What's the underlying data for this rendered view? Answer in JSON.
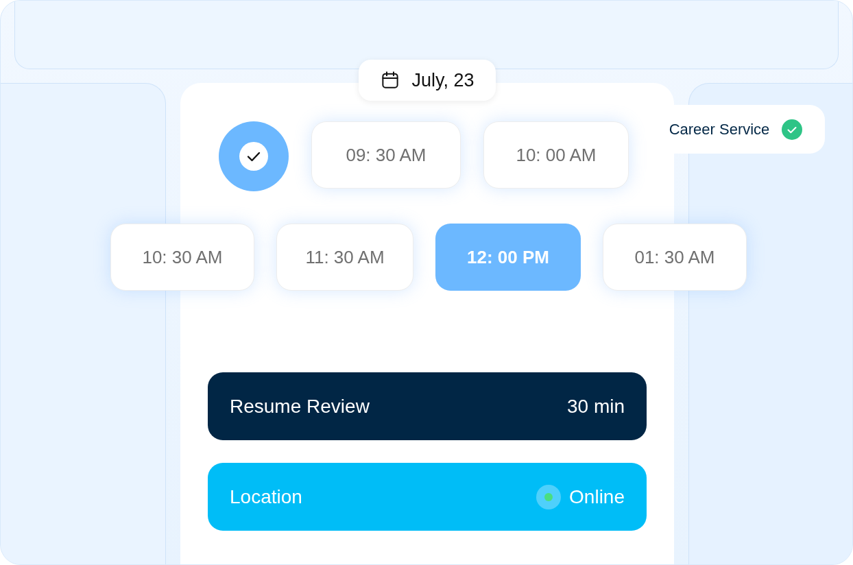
{
  "date_pill": {
    "label": "July, 23"
  },
  "badge": {
    "label": "Career Service"
  },
  "slot_rows": [
    [
      {
        "kind": "confirmed",
        "selected": true
      },
      {
        "kind": "time",
        "label": "09: 30 AM",
        "selected": false
      },
      {
        "kind": "time",
        "label": "10: 00 AM",
        "selected": false
      }
    ],
    [
      {
        "kind": "time",
        "label": "10: 30 AM",
        "selected": false
      },
      {
        "kind": "time",
        "label": "11: 30 AM",
        "selected": false
      },
      {
        "kind": "time",
        "label": "12: 00 PM",
        "selected": true
      },
      {
        "kind": "time",
        "label": "01: 30 AM",
        "selected": false
      }
    ]
  ],
  "session": {
    "title": "Resume Review",
    "duration": "30 min"
  },
  "location": {
    "label": "Location",
    "value": "Online",
    "color": "#4ade80"
  }
}
